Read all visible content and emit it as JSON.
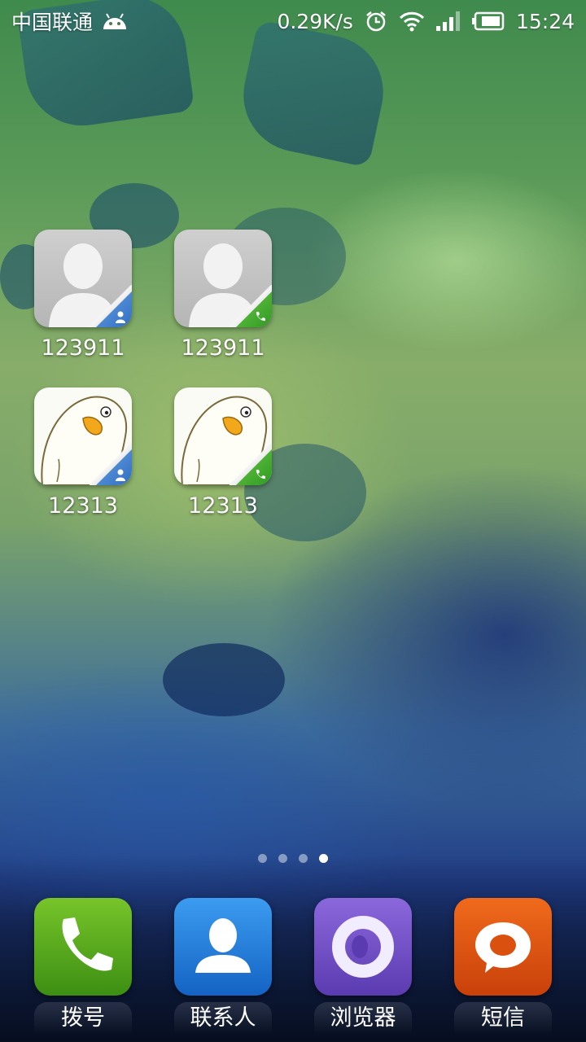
{
  "status_bar": {
    "carrier": "中国联通",
    "network_speed": "0.29K/s",
    "time": "15:24",
    "icons": [
      "android-icon",
      "alarm-icon",
      "wifi-icon",
      "signal-icon",
      "battery-icon"
    ]
  },
  "shortcuts": [
    {
      "label": "123911",
      "avatar": "default-person-icon",
      "badge": "contact-badge-icon",
      "badge_color": "#2f6fc4"
    },
    {
      "label": "123911",
      "avatar": "default-person-icon",
      "badge": "phone-badge-icon",
      "badge_color": "#2f9a21"
    },
    {
      "label": "12313",
      "avatar": "duck-avatar-icon",
      "badge": "contact-badge-icon",
      "badge_color": "#2f6fc4"
    },
    {
      "label": "12313",
      "avatar": "duck-avatar-icon",
      "badge": "phone-badge-icon",
      "badge_color": "#2f9a21"
    }
  ],
  "pager": {
    "count": 4,
    "active_index": 3
  },
  "dock": [
    {
      "label": "拨号",
      "icon": "phone-icon",
      "color": "#5aa81f"
    },
    {
      "label": "联系人",
      "icon": "person-icon",
      "color": "#1f7ad8"
    },
    {
      "label": "浏览器",
      "icon": "browser-ring-icon",
      "color": "#7050c8"
    },
    {
      "label": "短信",
      "icon": "chat-bubble-icon",
      "color": "#e0560f"
    }
  ]
}
